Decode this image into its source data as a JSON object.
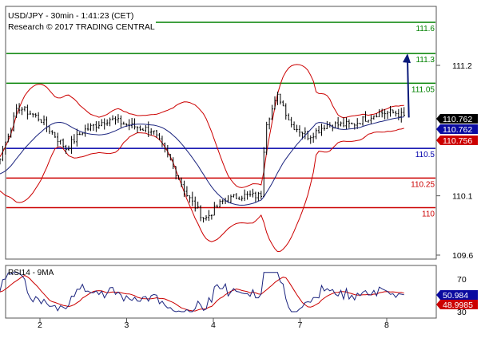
{
  "header": {
    "title": "USD/JPY - 30min - 1:41:23 (CET)",
    "subtitle": "Research © 2017 TRADING CENTRAL"
  },
  "colors": {
    "candles": "#000000",
    "bollinger": "#cc0000",
    "moving_average": "#1a237e",
    "resistance": "#008000",
    "pivot": "#0000aa",
    "support": "#cc0000",
    "arrow": "#0a1a7a",
    "rsi_line": "#1a237e",
    "rsi_signal": "#cc0000",
    "badge_blue": "#0a0aa0",
    "badge_red": "#cc0000",
    "badge_black": "#000000",
    "frame": "#555555"
  },
  "chart_data": [
    {
      "type": "candlestick",
      "panel": "price",
      "ylim": [
        109.5,
        111.4
      ],
      "y_ticks": [
        "111.2",
        "110.1",
        "109.6"
      ],
      "x_ticks": [
        "2",
        "3",
        "4",
        "7",
        "8"
      ],
      "overlays": [
        "Bollinger bands (red)",
        "moving average (dark blue)"
      ],
      "levels": [
        {
          "label": "111.6",
          "value": 111.6,
          "kind": "resistance",
          "shown_above_range": true
        },
        {
          "label": "111.3",
          "value": 111.3,
          "kind": "resistance"
        },
        {
          "label": "111.05",
          "value": 111.05,
          "kind": "resistance"
        },
        {
          "label": "110.5",
          "value": 110.5,
          "kind": "pivot"
        },
        {
          "label": "110.25",
          "value": 110.25,
          "kind": "support"
        },
        {
          "label": "110",
          "value": 110.0,
          "kind": "support"
        }
      ],
      "price_tags": [
        {
          "label": "110.762",
          "style": "black"
        },
        {
          "label": "110.762",
          "style": "blue"
        },
        {
          "label": "110.756",
          "style": "red"
        }
      ],
      "close_path": [
        [
          1,
          110.18
        ],
        [
          1.2,
          110.28
        ],
        [
          1.5,
          110.35
        ],
        [
          1.75,
          110.85
        ],
        [
          2.0,
          110.75
        ],
        [
          2.3,
          110.5
        ],
        [
          2.5,
          110.65
        ],
        [
          2.8,
          110.75
        ],
        [
          3.0,
          110.7
        ],
        [
          3.3,
          110.65
        ],
        [
          3.5,
          110.4
        ],
        [
          3.7,
          110.1
        ],
        [
          3.9,
          109.9
        ],
        [
          4.1,
          110.05
        ],
        [
          4.3,
          110.1
        ],
        [
          4.55,
          110.1
        ],
        [
          4.6,
          110.7
        ],
        [
          4.75,
          110.95
        ],
        [
          4.9,
          110.7
        ],
        [
          5.1,
          110.6
        ],
        [
          5.3,
          110.7
        ],
        [
          5.6,
          110.7
        ],
        [
          5.9,
          110.8
        ],
        [
          6.1,
          110.8
        ],
        [
          6.2,
          110.77
        ]
      ],
      "projection_arrow": {
        "from": 110.76,
        "to": 111.3
      }
    },
    {
      "type": "line",
      "panel": "rsi",
      "title": "RSI14 - 9MA",
      "ylim": [
        22,
        78
      ],
      "y_ticks": [
        "70",
        "30"
      ],
      "series": [
        {
          "name": "RSI14",
          "value_label": "50.984"
        },
        {
          "name": "9MA",
          "value_label": "48.9985"
        }
      ]
    }
  ]
}
